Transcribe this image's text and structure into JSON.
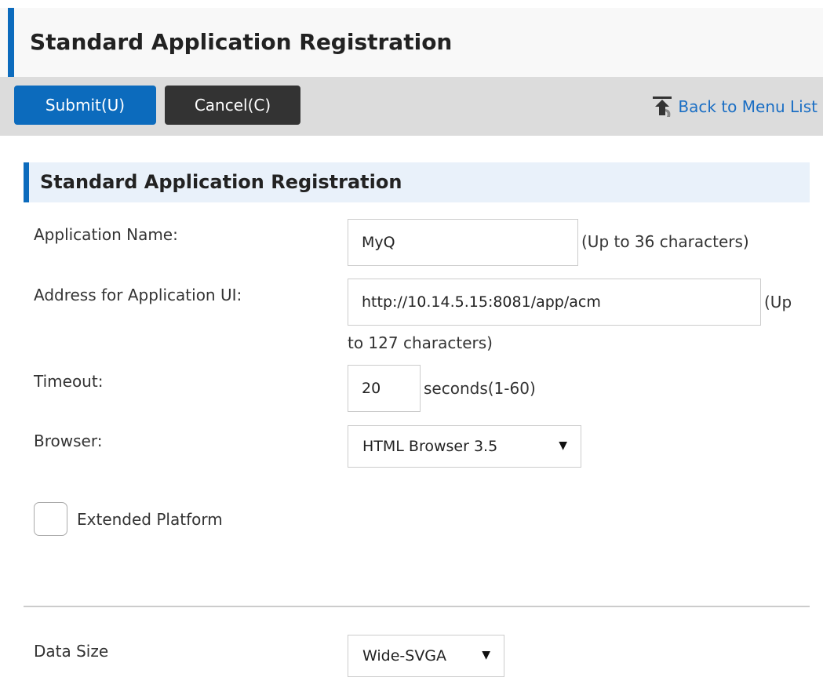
{
  "header": {
    "title": "Standard Application Registration"
  },
  "toolbar": {
    "submit_label": "Submit(U)",
    "cancel_label": "Cancel(C)",
    "back_link_label": "Back to Menu List",
    "back_icon": "back-arrow-up-icon"
  },
  "section": {
    "title": "Standard Application Registration"
  },
  "form": {
    "app_name": {
      "label": "Application Name:",
      "value": "MyQ",
      "hint": "(Up to 36 characters)"
    },
    "app_address": {
      "label": "Address for Application UI:",
      "value": "http://10.14.5.15:8081/app/acm",
      "hint_line1": "(Up",
      "hint_line2": "to 127 characters)"
    },
    "timeout": {
      "label": "Timeout:",
      "value": "20",
      "hint": "seconds(1-60)"
    },
    "browser": {
      "label": "Browser:",
      "selected": "HTML Browser 3.5"
    },
    "extended_platform": {
      "label": "Extended Platform",
      "checked": false
    },
    "data_size": {
      "label": "Data Size",
      "selected": "Wide-SVGA"
    }
  },
  "colors": {
    "accent": "#0c6bbd",
    "cancel": "#333333",
    "link": "#1a6ec4",
    "section_bg": "#e9f1fa"
  }
}
